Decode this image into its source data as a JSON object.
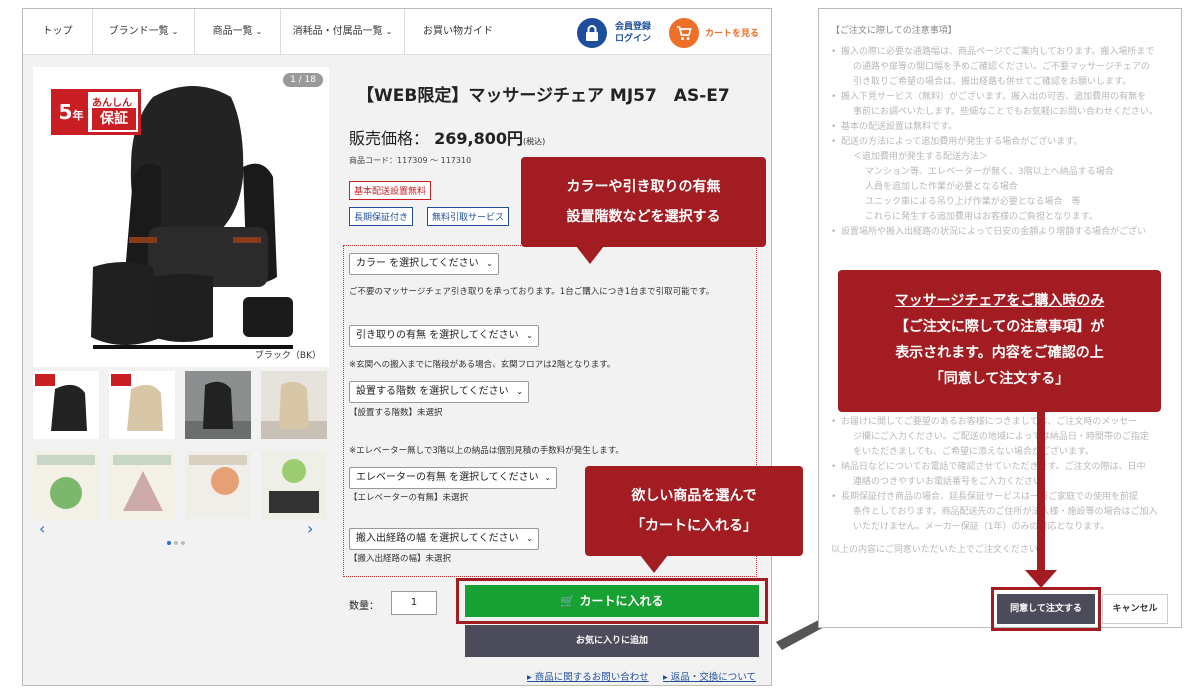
{
  "nav": {
    "items": [
      {
        "label": "トップ"
      },
      {
        "label": "ブランド一覧"
      },
      {
        "label": "商品一覧"
      },
      {
        "label": "消耗品・付属品一覧"
      },
      {
        "label": "お買い物ガイド"
      }
    ],
    "login_line1": "会員登録",
    "login_line2": "ログイン",
    "cart_label": "カートを見る"
  },
  "product": {
    "image_counter": "1 / 18",
    "badge_number": "5",
    "badge_unit": "年",
    "badge_top": "あんしん",
    "badge_main": "保証",
    "color_caption": "ブラック（BK）",
    "title": "【WEB限定】マッサージチェア MJ57　AS-E7",
    "price_label": "販売価格：",
    "price_value": "269,800円",
    "price_tax": "(税込)",
    "code": "商品コード：117309 ～ 117310",
    "tags_red": [
      "基本配送設置無料"
    ],
    "tags_blue": [
      "長期保証付き",
      "無料引取サービス"
    ]
  },
  "options": {
    "color_select": "カラー を選択してください",
    "pickup_note": "ご不要のマッサージチェア引き取りを承っております。1台ご購入につき1台まで引取可能です。",
    "pickup_select": "引き取りの有無 を選択してください",
    "floor_note": "※玄関への搬入までに階段がある場合、玄関フロアは2階となります。",
    "floor_select": "設置する階数 を選択してください",
    "floor_status": "【設置する階数】未選択",
    "elevator_note": "※エレベーター無しで3階以上の納品は個別見積の手数料が発生します。",
    "elevator_select": "エレベーターの有無 を選択してください",
    "elevator_status": "【エレベーターの有無】未選択",
    "path_select": "搬入出経路の幅 を選択してください",
    "path_status": "【搬入出経路の幅】未選択"
  },
  "purchase": {
    "qty_label": "数量：",
    "qty_value": "1",
    "cart_button": "カートに入れる",
    "fav_button": "お気に入りに追加",
    "link_inquiry": "商品に関するお問い合わせ",
    "link_return": "返品・交換について"
  },
  "callouts": {
    "options_line1": "カラーや引き取りの有無",
    "options_line2": "設置階数などを選択する",
    "cart_line1": "欲しい商品を選んで",
    "cart_line2": "「カートに入れる」",
    "dialog_line1": "マッサージチェアをご購入時のみ",
    "dialog_line2": "【ご注文に際しての注意事項】が",
    "dialog_line3": "表示されます。内容をご確認の上",
    "dialog_line4": "「同意して注文する」"
  },
  "dialog": {
    "title": "【ご注文に際しての注意事項】",
    "lines": [
      "搬入の際に必要な通路幅は、商品ページでご案内しております。搬入場所まで",
      "の通路や扉等の開口幅を予めご確認ください。ご不要マッサージチェアの",
      "引き取りご希望の場合は、搬出経路も併せてご確認をお願いします。",
      "搬入下見サービス（無料）がございます。搬入出の可否、追加費用の有無を",
      "事前にお調べいたします。些細なことでもお気軽にお問い合わせください。",
      "基本の配送設置は無料です。",
      "配送の方法によって追加費用が発生する場合がございます。",
      "＜追加費用が発生する配送方法＞",
      "マンション等、エレベーターが無く、3階以上へ納品する場合",
      "人員を追加した作業が必要となる場合",
      "ユニック車による吊り上げ作業が必要となる場合　等",
      "これらに発生する追加費用はお客様のご負担となります。",
      "設置場所や搬入出経路の状況によって日安の金額より増額する場合がござい"
    ],
    "lines_lower": [
      "お届けに関してご要望のあるお客様につきましては、ご注文時のメッセー",
      "ジ欄にご入力ください。ご配送の地域によっては納品日・時間帯のご指定",
      "をいただきましても、ご希望に添えない場合がございます。",
      "納品日などについてお電話で確認させていただきます。ご注文の際は、日中",
      "連絡のつきやすいお電話番号をご入力ください。",
      "長期保証付き商品の場合、延長保証サービスは一般ご家庭での使用を前提",
      "条件としております。商品配送先のご住所が法人様・施設等の場合はご加入",
      "いただけません。メーカー保証（1年）のみの対応となります。",
      "以上の内容にご同意いただいた上でご注文ください。"
    ],
    "agree_button": "同意して注文する",
    "cancel_button": "キャンセル"
  },
  "colors": {
    "accent_red": "#a31c22",
    "cart_green": "#17a133",
    "brand_blue": "#1f4f9c",
    "cart_orange": "#ee6f27",
    "dark_button": "#4b4b5a"
  }
}
